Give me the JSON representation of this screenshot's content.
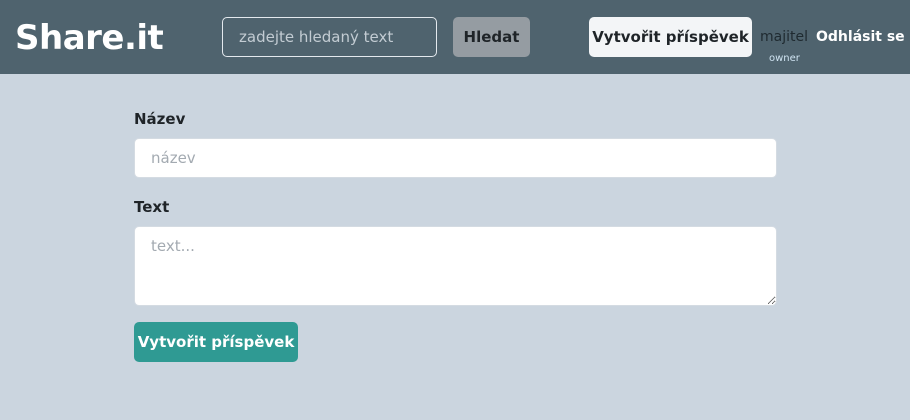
{
  "header": {
    "brand": "Share.it",
    "search_placeholder": "zadejte hledaný text",
    "search_button": "Hledat",
    "create_post_button": "Vytvořit příspěvek",
    "username": "majitel",
    "role": "owner",
    "logout": "Odhlásit se"
  },
  "form": {
    "title_label": "Název",
    "title_placeholder": "název",
    "text_label": "Text",
    "text_placeholder": "text...",
    "submit_button": "Vytvořit příspěvek"
  },
  "colors": {
    "navbar": "#4f636e",
    "background": "#cbd5df",
    "accent": "#2f9a93"
  }
}
